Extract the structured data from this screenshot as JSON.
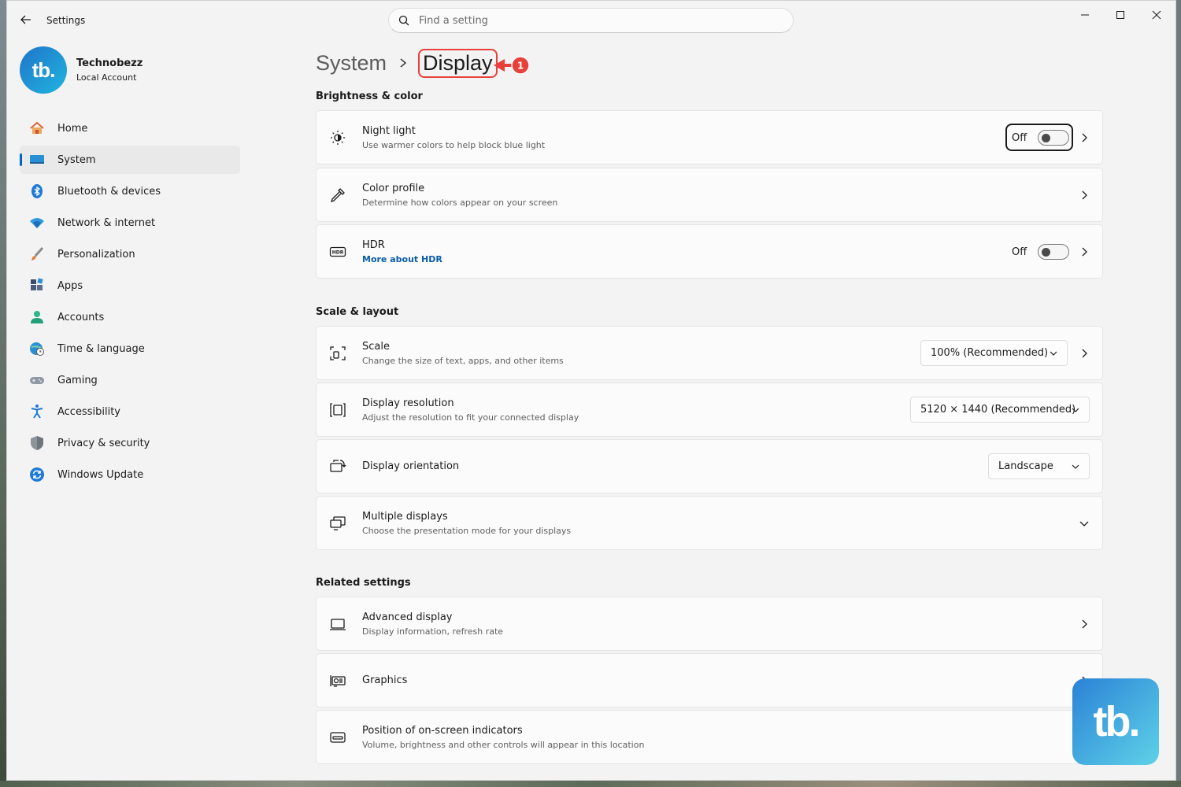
{
  "window": {
    "app_title": "Settings"
  },
  "search": {
    "placeholder": "Find a setting"
  },
  "profile": {
    "avatar_text": "tb.",
    "name": "Technobezz",
    "account_type": "Local Account"
  },
  "sidebar": {
    "items": [
      {
        "label": "Home",
        "icon": "home-icon"
      },
      {
        "label": "System",
        "icon": "monitor-icon",
        "active": true
      },
      {
        "label": "Bluetooth & devices",
        "icon": "bluetooth-icon"
      },
      {
        "label": "Network & internet",
        "icon": "wifi-icon"
      },
      {
        "label": "Personalization",
        "icon": "brush-icon"
      },
      {
        "label": "Apps",
        "icon": "apps-icon"
      },
      {
        "label": "Accounts",
        "icon": "person-icon"
      },
      {
        "label": "Time & language",
        "icon": "globe-clock-icon"
      },
      {
        "label": "Gaming",
        "icon": "gamepad-icon"
      },
      {
        "label": "Accessibility",
        "icon": "accessibility-icon"
      },
      {
        "label": "Privacy & security",
        "icon": "shield-icon"
      },
      {
        "label": "Windows Update",
        "icon": "update-icon"
      }
    ]
  },
  "breadcrumb": {
    "parent": "System",
    "current": "Display",
    "annotation_number": "1"
  },
  "sections": {
    "brightness": "Brightness & color",
    "scale": "Scale & layout",
    "related": "Related settings"
  },
  "cards": {
    "night_light": {
      "title": "Night light",
      "subtitle": "Use warmer colors to help block blue light",
      "state": "Off"
    },
    "color_profile": {
      "title": "Color profile",
      "subtitle": "Determine how colors appear on your screen"
    },
    "hdr": {
      "title": "HDR",
      "link": "More about HDR",
      "state": "Off"
    },
    "scale": {
      "title": "Scale",
      "subtitle": "Change the size of text, apps, and other items",
      "value": "100% (Recommended)"
    },
    "resolution": {
      "title": "Display resolution",
      "subtitle": "Adjust the resolution to fit your connected display",
      "value": "5120 × 1440 (Recommended)"
    },
    "orientation": {
      "title": "Display orientation",
      "value": "Landscape"
    },
    "multiple": {
      "title": "Multiple displays",
      "subtitle": "Choose the presentation mode for your displays"
    },
    "advanced": {
      "title": "Advanced display",
      "subtitle": "Display information, refresh rate"
    },
    "graphics": {
      "title": "Graphics"
    },
    "osd": {
      "title": "Position of on-screen indicators",
      "subtitle": "Volume, brightness and other controls will appear in this location"
    }
  },
  "watermark": {
    "text": "tb."
  },
  "colors": {
    "accent": "#0067c0",
    "annotation": "#e8403a"
  }
}
